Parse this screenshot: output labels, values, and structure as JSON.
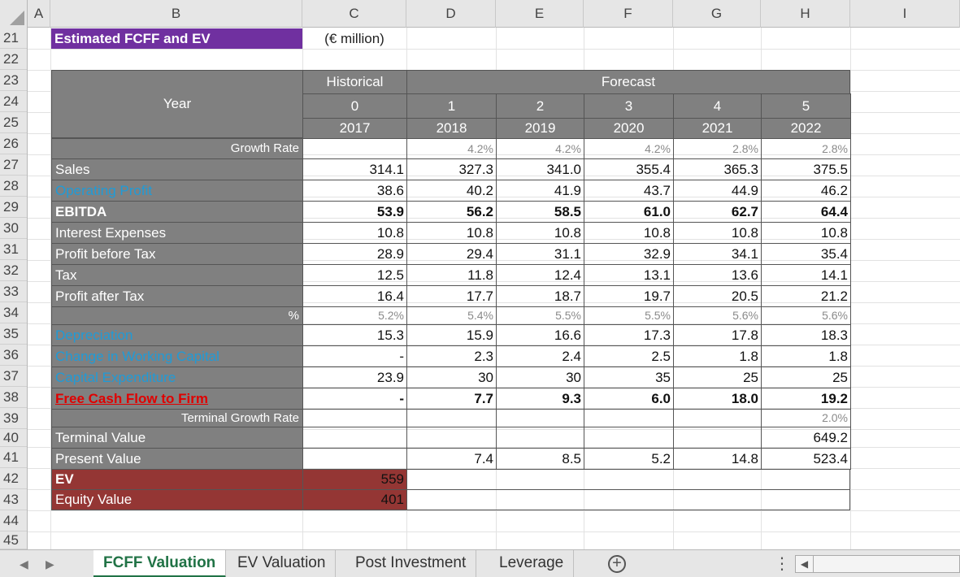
{
  "columns": [
    "A",
    "B",
    "C",
    "D",
    "E",
    "F",
    "G",
    "H",
    "I"
  ],
  "rows": [
    "21",
    "22",
    "23",
    "24",
    "25",
    "26",
    "27",
    "28",
    "29",
    "30",
    "31",
    "32",
    "33",
    "34",
    "35",
    "36",
    "37",
    "38",
    "39",
    "40",
    "41",
    "42",
    "43",
    "44",
    "45"
  ],
  "sheet": {
    "title": "Estimated FCFF and EV",
    "unit": "(€ million)",
    "header": {
      "year_label": "Year",
      "historical": "Historical",
      "forecast": "Forecast",
      "index": [
        "0",
        "1",
        "2",
        "3",
        "4",
        "5"
      ],
      "years": [
        "2017",
        "2018",
        "2019",
        "2020",
        "2021",
        "2022"
      ]
    },
    "lines": [
      {
        "label": "Growth Rate",
        "values": [
          "",
          "4.2%",
          "4.2%",
          "4.2%",
          "2.8%",
          "2.8%"
        ]
      },
      {
        "label": "Sales",
        "values": [
          "314.1",
          "327.3",
          "341.0",
          "355.4",
          "365.3",
          "375.5"
        ]
      },
      {
        "label": "Operating Profit",
        "values": [
          "38.6",
          "40.2",
          "41.9",
          "43.7",
          "44.9",
          "46.2"
        ]
      },
      {
        "label": "EBITDA",
        "values": [
          "53.9",
          "56.2",
          "58.5",
          "61.0",
          "62.7",
          "64.4"
        ]
      },
      {
        "label": "Interest Expenses",
        "values": [
          "10.8",
          "10.8",
          "10.8",
          "10.8",
          "10.8",
          "10.8"
        ]
      },
      {
        "label": "Profit before Tax",
        "values": [
          "28.9",
          "29.4",
          "31.1",
          "32.9",
          "34.1",
          "35.4"
        ]
      },
      {
        "label": "Tax",
        "values": [
          "12.5",
          "11.8",
          "12.4",
          "13.1",
          "13.6",
          "14.1"
        ]
      },
      {
        "label": "Profit after Tax",
        "values": [
          "16.4",
          "17.7",
          "18.7",
          "19.7",
          "20.5",
          "21.2"
        ]
      },
      {
        "label": "%",
        "values": [
          "5.2%",
          "5.4%",
          "5.5%",
          "5.5%",
          "5.6%",
          "5.6%"
        ]
      },
      {
        "label": "Depreciation",
        "values": [
          "15.3",
          "15.9",
          "16.6",
          "17.3",
          "17.8",
          "18.3"
        ]
      },
      {
        "label": "Change in Working Capital",
        "values": [
          "-",
          "2.3",
          "2.4",
          "2.5",
          "1.8",
          "1.8"
        ]
      },
      {
        "label": "Capital Expenditure",
        "values": [
          "23.9",
          "30",
          "30",
          "35",
          "25",
          "25"
        ]
      },
      {
        "label": "Free Cash Flow to Firm",
        "values": [
          "-",
          "7.7",
          "9.3",
          "6.0",
          "18.0",
          "19.2"
        ]
      },
      {
        "label": "Terminal Growth Rate",
        "values": [
          "",
          "",
          "",
          "",
          "",
          "2.0%"
        ]
      },
      {
        "label": "Terminal Value",
        "values": [
          "",
          "",
          "",
          "",
          "",
          "649.2"
        ]
      },
      {
        "label": "Present Value",
        "values": [
          "",
          "7.4",
          "8.5",
          "5.2",
          "14.8",
          "523.4"
        ]
      }
    ],
    "ev": {
      "label": "EV",
      "value": "559"
    },
    "equity": {
      "label": "Equity Value",
      "value": "401"
    }
  },
  "tabs": [
    "FCFF Valuation",
    "EV Valuation",
    "Post Investment",
    "Leverage"
  ],
  "add_sheet_symbol": "+",
  "overflow_symbol": "⋮",
  "colors": {
    "title_bg": "#7030a0",
    "gray": "#808080",
    "ev_bg": "#943634",
    "blue_label": "#1f9bd7",
    "red_label": "#e00000",
    "active_tab": "#217346"
  }
}
